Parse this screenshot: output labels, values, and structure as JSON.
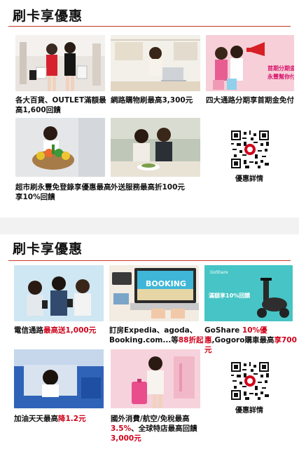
{
  "section1": {
    "title": "刷卡享優惠",
    "cards": [
      {
        "caption": "各大百貨、OUTLET滿額最高1,600回饋"
      },
      {
        "caption": "網路購物刷最高3,300元"
      },
      {
        "caption": "四大通路分期享首期金免付",
        "banner_line1": "首期分期金",
        "banner_line2": "永豐幫你付"
      },
      {
        "caption": "超市刷永豐免登錄享優惠最高享10%回饋"
      },
      {
        "caption": "外送服務最高折100元"
      }
    ],
    "qr_label": "優惠詳情"
  },
  "section2": {
    "title": "刷卡享優惠",
    "cards": [
      {
        "caption_a": "電信通路",
        "caption_b": "最高送1,000元"
      },
      {
        "caption_a": "訂房Expedia、agoda、Booking.com...等",
        "caption_b": "88折起",
        "booking_word": "BOOKING"
      },
      {
        "caption_a": "GoShare ",
        "caption_b": "10%優惠",
        "caption_c": ",",
        "caption_d": "Gogoro購車最高",
        "caption_e": "享700元",
        "scooter_text": "滿額享10%回饋",
        "brand": "GoShare"
      },
      {
        "caption_a": "加油天天最高",
        "caption_b": "降1.2元"
      },
      {
        "caption_a": "國外消費/航空/免稅最高",
        "caption_b": "3.5%",
        "caption_c": "、全球特店最高回饋",
        "caption_d": "3,000元"
      }
    ],
    "qr_label": "優惠詳情"
  },
  "colors": {
    "accent_red": "#d0021b",
    "rule_red": "#c0392b"
  }
}
